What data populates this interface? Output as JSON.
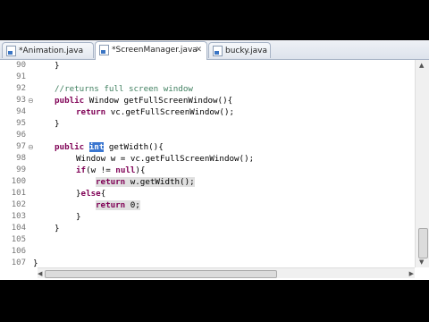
{
  "tabs": [
    {
      "label": "*Animation.java",
      "active": false
    },
    {
      "label": "*ScreenManager.java",
      "active": true
    },
    {
      "label": "bucky.java",
      "active": false
    }
  ],
  "close_glyph": "✕",
  "line_numbers": [
    "90",
    "91",
    "92",
    "93",
    "94",
    "95",
    "96",
    "97",
    "98",
    "99",
    "100",
    "101",
    "102",
    "103",
    "104",
    "105",
    "106",
    "107"
  ],
  "code": {
    "l90_brace": "}",
    "l92_comment": "//returns full screen window",
    "l93_kw": "public",
    "l93_rest": " Window getFullScreenWindow(){",
    "l94_kw": "return",
    "l94_rest": " vc.getFullScreenWindow();",
    "l95_brace": "}",
    "l97_kw": "public",
    "l97_sel": "int",
    "l97_rest": " getWidth(){",
    "l98_text": "Window w = vc.getFullScreenWindow();",
    "l99_kw": "if",
    "l99_rest": "(w != ",
    "l99_null": "null",
    "l99_end": "){",
    "l100_kw": "return",
    "l100_rest": " w.getWidth();",
    "l101_pre": "}",
    "l101_kw": "else",
    "l101_end": "{",
    "l102_kw": "return",
    "l102_rest": " 0;",
    "l103_brace": "}",
    "l104_brace": "}",
    "l107_brace": "}"
  },
  "fold_markers": {
    "l93": "⊖",
    "l97": "⊖"
  },
  "scroll_arrows": {
    "up": "▲",
    "down": "▼",
    "left": "◀",
    "right": "▶"
  },
  "colors": {
    "keyword": "#7f0055",
    "comment": "#3f7f5f",
    "selection": "#3a76d0",
    "line_number": "#777777"
  }
}
